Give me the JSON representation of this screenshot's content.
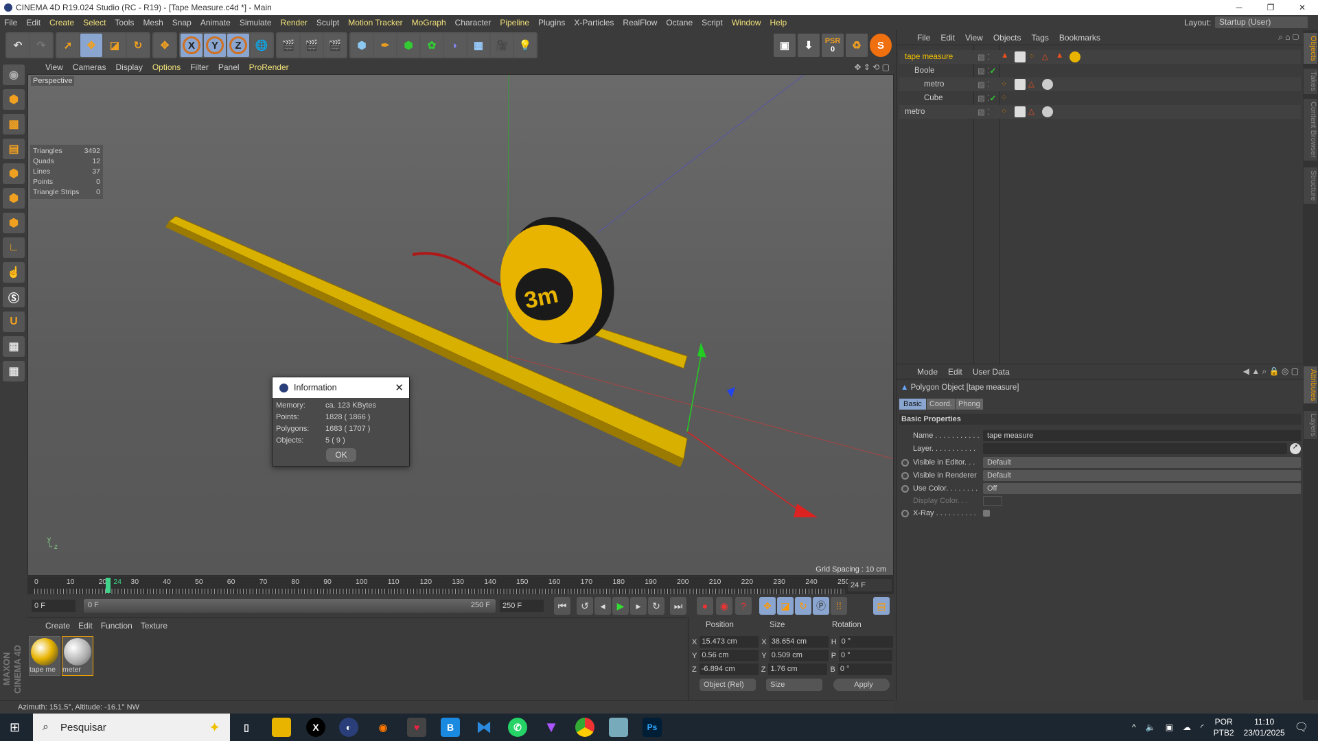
{
  "title": "CINEMA 4D R19.024 Studio (RC - R19) - [Tape Measure.c4d *] - Main",
  "menu": [
    "File",
    "Edit",
    "Create",
    "Select",
    "Tools",
    "Mesh",
    "Snap",
    "Animate",
    "Simulate",
    "Render",
    "Sculpt",
    "Motion Tracker",
    "MoGraph",
    "Character",
    "Pipeline",
    "Plugins",
    "X-Particles",
    "RealFlow",
    "Octane",
    "Script",
    "Window",
    "Help"
  ],
  "layout": {
    "label": "Layout:",
    "value": "Startup (User)"
  },
  "toolbar": {
    "psr_label": "PSR",
    "psr_value": "0"
  },
  "viewport": {
    "menu": [
      "View",
      "Cameras",
      "Display",
      "Options",
      "Filter",
      "Panel",
      "ProRender"
    ],
    "label": "Perspective",
    "grid_spacing": "Grid Spacing : 10 cm",
    "stats": [
      {
        "k": "Triangles",
        "v": "3492"
      },
      {
        "k": "Quads",
        "v": "12"
      },
      {
        "k": "Lines",
        "v": "37"
      },
      {
        "k": "Points",
        "v": "0"
      },
      {
        "k": "Triangle Strips",
        "v": "0"
      }
    ],
    "tape_label": "3m"
  },
  "info_dialog": {
    "title": "Information",
    "rows": [
      {
        "k": "Memory:",
        "v": "ca. 123 KBytes"
      },
      {
        "k": "Points:",
        "v": "1828 ( 1866 )"
      },
      {
        "k": "Polygons:",
        "v": "1683 ( 1707 )"
      },
      {
        "k": "Objects:",
        "v": "5 ( 9 )"
      }
    ],
    "ok": "OK"
  },
  "timeline": {
    "ticks": [
      "0",
      "10",
      "20",
      "24",
      "30",
      "40",
      "50",
      "60",
      "70",
      "80",
      "90",
      "100",
      "110",
      "120",
      "130",
      "140",
      "150",
      "160",
      "170",
      "180",
      "190",
      "200",
      "210",
      "220",
      "230",
      "240",
      "250"
    ],
    "current": "24 F",
    "current_frame": 24,
    "start": "0 F",
    "range_start": "0 F",
    "range_end": "250 F",
    "end": "250 F"
  },
  "materials": {
    "menu": [
      "Create",
      "Edit",
      "Function",
      "Texture"
    ],
    "items": [
      "tape me",
      "meter"
    ]
  },
  "coords": {
    "headers": [
      "Position",
      "Size",
      "Rotation"
    ],
    "rows": [
      {
        "a": "X",
        "p": "15.473 cm",
        "s": "38.654 cm",
        "r": "H",
        "rv": "0 °"
      },
      {
        "a": "Y",
        "p": "0.56 cm",
        "s": "0.509 cm",
        "r": "P",
        "rv": "0 °"
      },
      {
        "a": "Z",
        "p": "-6.894 cm",
        "s": "1.76 cm",
        "r": "B",
        "rv": "0 °"
      }
    ],
    "mode": "Object (Rel)",
    "size_mode": "Size",
    "apply": "Apply"
  },
  "status": "Azimuth: 151.5°, Altitude: -16.1°  NW",
  "objects": {
    "menu": [
      "File",
      "Edit",
      "View",
      "Objects",
      "Tags",
      "Bookmarks"
    ],
    "items": [
      "tape measure",
      "Boole",
      "metro",
      "Cube",
      "metro"
    ]
  },
  "attributes": {
    "menu": [
      "Mode",
      "Edit",
      "User Data"
    ],
    "title": "Polygon Object [tape measure]",
    "tabs": [
      "Basic",
      "Coord.",
      "Phong"
    ],
    "section": "Basic Properties",
    "fields": [
      {
        "k": "Name . . . . . . . . . . .",
        "v": "tape measure"
      },
      {
        "k": "Layer. . . . . . . . . . .",
        "v": ""
      },
      {
        "k": "Visible in Editor. . .",
        "v": "Default"
      },
      {
        "k": "Visible in Renderer",
        "v": "Default"
      },
      {
        "k": "Use Color. . . . . . . .",
        "v": "Off"
      },
      {
        "k": "Display Color. . .",
        "v": ""
      },
      {
        "k": "X-Ray . . . . . . . . . .",
        "v": ""
      }
    ]
  },
  "side_tabs": [
    "Objects",
    "Takes",
    "Content Browser",
    "Structure",
    "Attributes",
    "Layers"
  ],
  "taskbar": {
    "search": "Pesquisar",
    "lang1": "POR",
    "lang2": "PTB2",
    "time": "11:10",
    "date": "23/01/2025"
  }
}
